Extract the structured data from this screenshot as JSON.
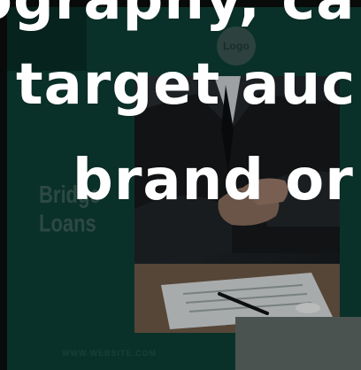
{
  "design": {
    "logo_label": "Logo",
    "title_lines": [
      "Bridge",
      "Loans"
    ],
    "website": "WWW.WEBSITE.COM"
  },
  "caption": {
    "lines": [
      "ography, ca",
      "target auc",
      "brand or"
    ]
  },
  "colors": {
    "card_green": "#0e3f35",
    "card_dark_green": "#0a2e27",
    "caption_text": "#ffffff",
    "background": "#0b0f0e"
  },
  "icons": {
    "photo": "handshake-photo"
  }
}
